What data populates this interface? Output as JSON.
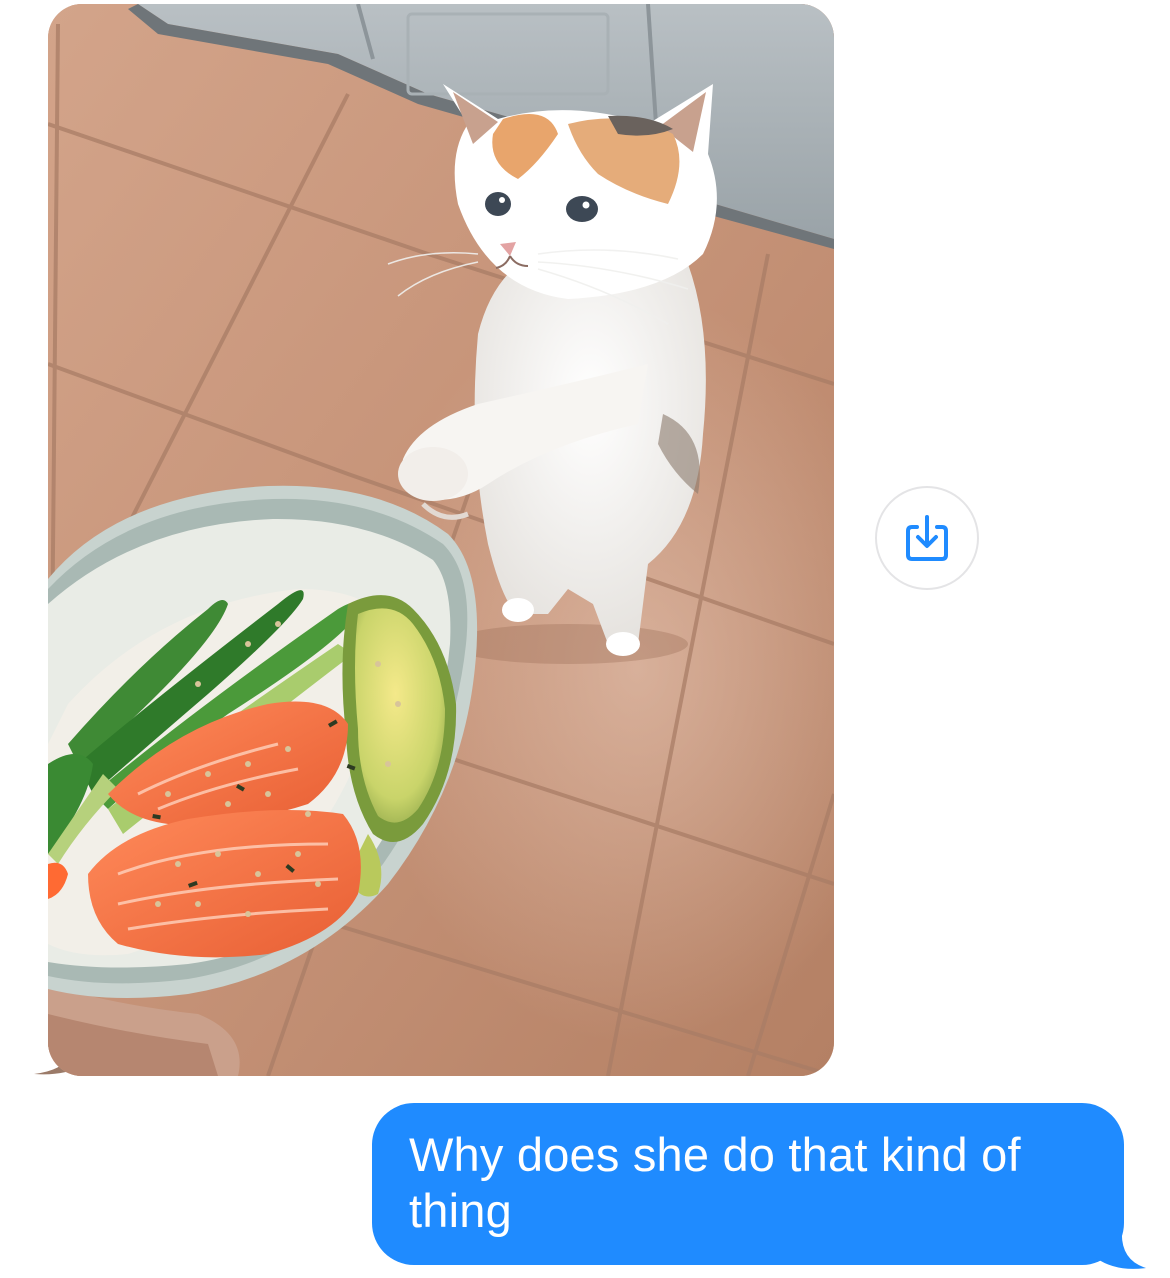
{
  "conversation": {
    "incoming": {
      "type": "photo",
      "image_description_icon": "cat-photo",
      "save_button_icon": "save-to-device-icon"
    },
    "outgoing": {
      "text": "Why does she do that kind of thing"
    }
  },
  "colors": {
    "outgoing_bubble": "#1f8bff",
    "save_icon": "#1f8bff",
    "background": "#ffffff"
  }
}
